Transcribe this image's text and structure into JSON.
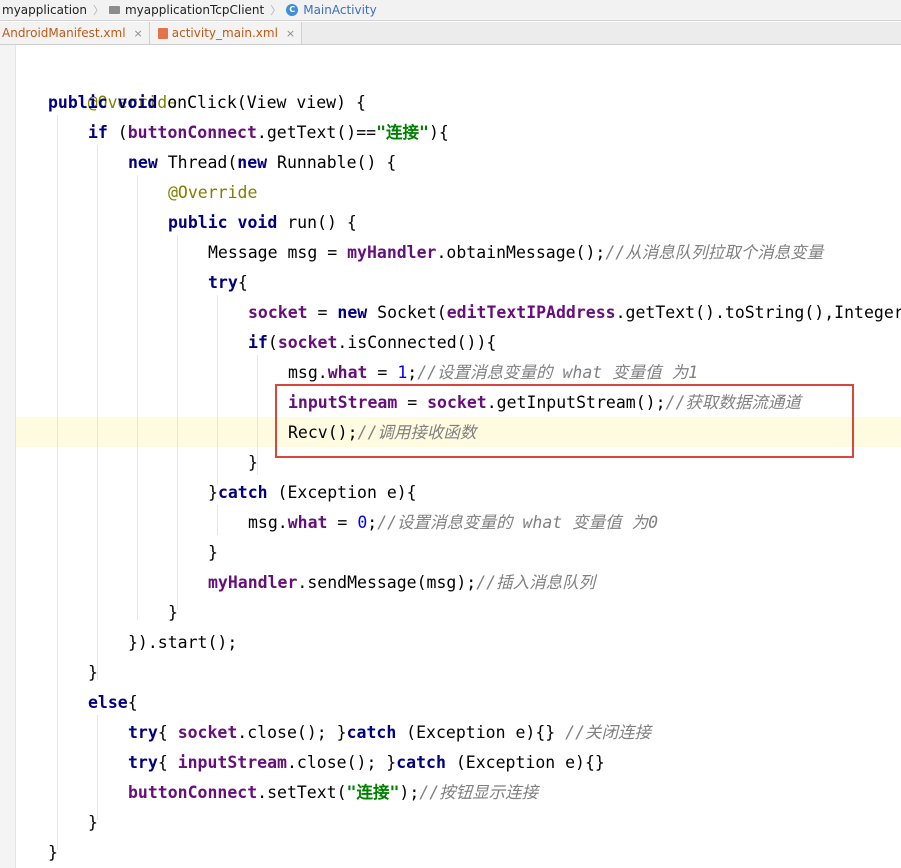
{
  "breadcrumb": {
    "items": [
      {
        "label": "myapplication",
        "icon": "none"
      },
      {
        "label": "myapplicationTcpClient",
        "icon": "folder-icon"
      },
      {
        "label": "MainActivity",
        "icon": "class-icon",
        "badge": "C"
      }
    ],
    "separator": "〉"
  },
  "tabs": [
    {
      "label": "AndroidManifest.xml",
      "close": "×"
    },
    {
      "label": "activity_main.xml",
      "close": "×"
    }
  ],
  "code": {
    "l1": {
      "t0": "@Override"
    },
    "l2": {
      "t0": "public",
      "t1": " ",
      "t2": "void",
      "t3": " onClick(View view) {"
    },
    "l3": {
      "t0": "if",
      "t1": " (",
      "t2": "buttonConnect",
      "t3": ".getText()==",
      "t4": "\"连接\"",
      "t5": "){"
    },
    "l4": {
      "t0": "new",
      "t1": " Thread(",
      "t2": "new",
      "t3": " Runnable() {"
    },
    "l5": {
      "t0": "@Override"
    },
    "l6": {
      "t0": "public",
      "t1": " ",
      "t2": "void",
      "t3": " run() {"
    },
    "l7": {
      "t0": "Message msg = ",
      "t1": "myHandler",
      "t2": ".obtainMessage();",
      "t3": "//从消息队列拉取个消息变量"
    },
    "l8": {
      "t0": "try",
      "t1": "{"
    },
    "l9": {
      "t0": "socket",
      "t1": " = ",
      "t2": "new",
      "t3": " Socket(",
      "t4": "editTextIPAddress",
      "t5": ".getText().toString(),Integer.valueOf("
    },
    "l10": {
      "t0": "if",
      "t1": "(",
      "t2": "socket",
      "t3": ".isConnected()){"
    },
    "l11": {
      "t0": "msg.",
      "t1": "what",
      "t2": " = ",
      "t3": "1",
      "t4": ";",
      "t5": "//设置消息变量的 what 变量值 为1"
    },
    "l12": {
      "t0": "inputStream",
      "t1": " = ",
      "t2": "socket",
      "t3": ".getInputStream();",
      "t4": "//获取数据流通道"
    },
    "l13": {
      "t0": "Recv();",
      "t1": "//调用接收函数"
    },
    "l14": {
      "t0": "}"
    },
    "l15": {
      "t0": "}",
      "t1": "catch",
      "t2": " (Exception e){"
    },
    "l16": {
      "t0": "msg.",
      "t1": "what",
      "t2": " = ",
      "t3": "0",
      "t4": ";",
      "t5": "//设置消息变量的 what 变量值 为0"
    },
    "l17": {
      "t0": "}"
    },
    "l18": {
      "t0": "myHandler",
      "t1": ".sendMessage(msg);",
      "t2": "//插入消息队列"
    },
    "l19": {
      "t0": "}"
    },
    "l20": {
      "t0": "}).start();"
    },
    "l21": {
      "t0": "}"
    },
    "l22": {
      "t0": "else",
      "t1": "{"
    },
    "l23": {
      "t0": "try",
      "t1": "{ ",
      "t2": "socket",
      "t3": ".close(); }",
      "t4": "catch",
      "t5": " (Exception e){} ",
      "t6": "//关闭连接"
    },
    "l24": {
      "t0": "try",
      "t1": "{ ",
      "t2": "inputStream",
      "t3": ".close(); }",
      "t4": "catch",
      "t5": " (Exception e){}"
    },
    "l25": {
      "t0": "buttonConnect",
      "t1": ".setText(",
      "t2": "\"连接\"",
      "t3": ");",
      "t4": "//按钮显示连接"
    },
    "l26": {
      "t0": "}"
    },
    "l27": {
      "t0": "}"
    }
  },
  "colors": {
    "keyword": "#000080",
    "annotation": "#808000",
    "field": "#660e7a",
    "string": "#008000",
    "number": "#0000ff",
    "comment": "#808080",
    "highlight_box": "#d9463e",
    "caret_line": "#fffbe0"
  }
}
